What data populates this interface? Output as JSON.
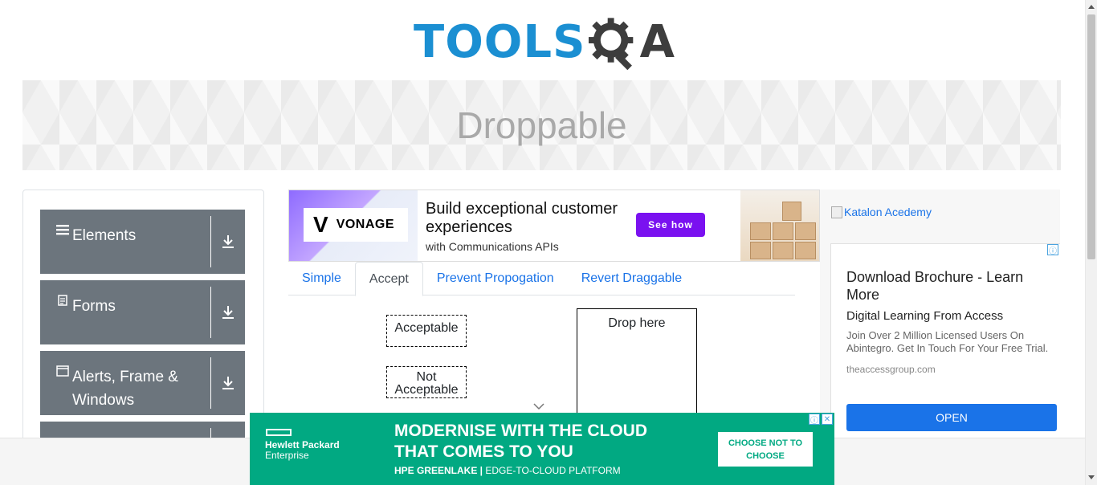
{
  "header": {
    "logo_tools": "TOOLS",
    "logo_qa": "A",
    "brand_colors": {
      "tools": "#1b8fd2",
      "qa": "#3d3d3d"
    }
  },
  "banner": {
    "title": "Droppable"
  },
  "sidebar": {
    "groups": [
      {
        "label": "Elements",
        "icon": "hamburger-icon"
      },
      {
        "label": "Forms",
        "icon": "document-icon"
      },
      {
        "label": "Alerts, Frame & Windows",
        "icon": "window-icon"
      }
    ]
  },
  "ad_top": {
    "brand": "VONAGE",
    "headline": "Build exceptional customer experiences",
    "subline": "with Communications APIs",
    "cta": "See how",
    "accent": "#7a11f0"
  },
  "tabs": [
    {
      "label": "Simple",
      "active": false
    },
    {
      "label": "Accept",
      "active": true
    },
    {
      "label": "Prevent Propogation",
      "active": false
    },
    {
      "label": "Revert Draggable",
      "active": false
    }
  ],
  "drag_items": {
    "acceptable": "Acceptable",
    "not_acceptable": "Not Acceptable"
  },
  "drop_zone": {
    "label": "Drop here"
  },
  "right_ad": {
    "katalon_alt": "Katalon Acedemy",
    "title": "Download Brochure - Learn More",
    "subtitle": "Digital Learning From Access",
    "body": "Join Over 2 Million Licensed Users On Abintegro. Get In Touch For Your Free Trial.",
    "url": "theaccessgroup.com",
    "button": "OPEN",
    "button_color": "#1a73e8"
  },
  "bottom_ad": {
    "brand_line1": "Hewlett Packard",
    "brand_line2": "Enterprise",
    "headline": "MODERNISE WITH THE CLOUD THAT COMES TO YOU",
    "sub_bold": "HPE GREENLAKE |",
    "sub_rest": " EDGE-TO-CLOUD PLATFORM",
    "cta": "CHOOSE NOT TO CHOOSE",
    "bg_color": "#01a982"
  },
  "ad_choices": {
    "info": "ⓘ",
    "close": "✕"
  }
}
